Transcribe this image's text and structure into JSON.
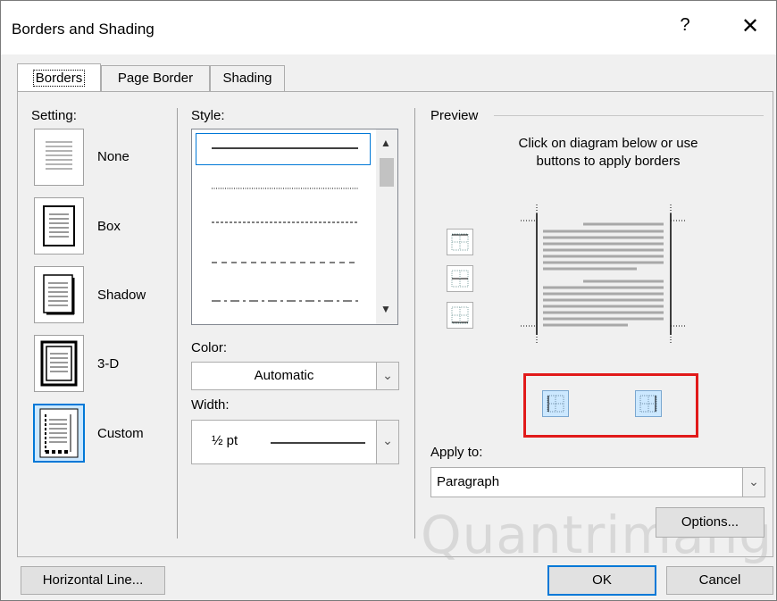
{
  "dialog": {
    "title": "Borders and Shading",
    "help_label": "?",
    "close_label": "✕"
  },
  "tabs": [
    {
      "label": "Borders",
      "active": true
    },
    {
      "label": "Page Border",
      "active": false
    },
    {
      "label": "Shading",
      "active": false
    }
  ],
  "setting": {
    "header": "Setting:",
    "items": [
      {
        "label": "None",
        "selected": false
      },
      {
        "label": "Box",
        "selected": false
      },
      {
        "label": "Shadow",
        "selected": false
      },
      {
        "label": "3-D",
        "selected": false
      },
      {
        "label": "Custom",
        "selected": true
      }
    ]
  },
  "style": {
    "header": "Style:",
    "options": [
      "solid",
      "dotted",
      "dashed-fine",
      "dashed",
      "dash-dot"
    ]
  },
  "color": {
    "header": "Color:",
    "value": "Automatic"
  },
  "width": {
    "header": "Width:",
    "value": "½ pt"
  },
  "preview": {
    "header": "Preview",
    "instructions": "Click on diagram below or use\nbuttons to apply borders",
    "side_buttons": [
      "top-border-icon",
      "inside-horizontal-border-icon",
      "bottom-border-icon"
    ],
    "bottom_buttons": [
      "left-border-icon",
      "right-border-icon"
    ]
  },
  "apply_to": {
    "header": "Apply to:",
    "value": "Paragraph"
  },
  "buttons": {
    "options": "Options...",
    "horizontal_line": "Horizontal Line...",
    "ok": "OK",
    "cancel": "Cancel"
  },
  "watermark": "Quantrimang",
  "colors": {
    "accent": "#0078d7",
    "highlight": "#e11a1a",
    "selected_bg": "#cce8ff"
  }
}
